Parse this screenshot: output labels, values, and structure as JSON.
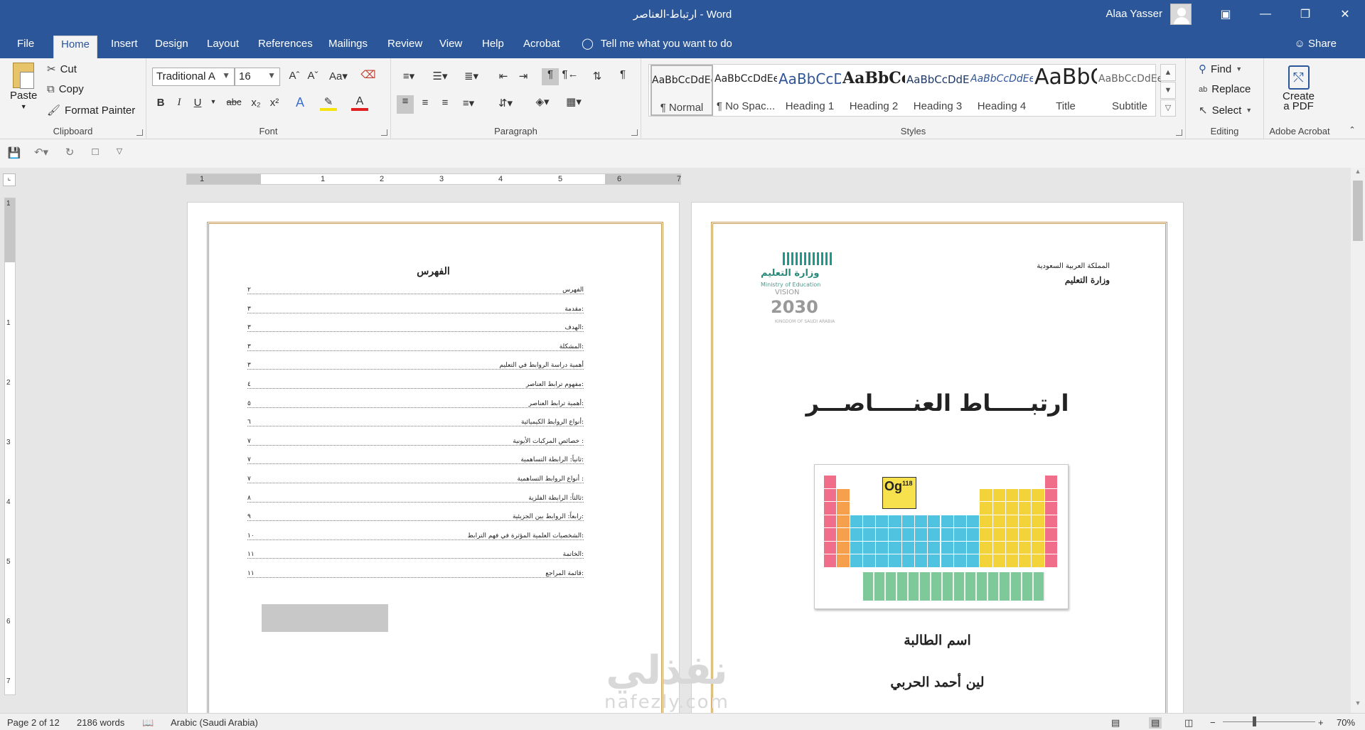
{
  "window": {
    "title": "ارتباط-العناصر  -  Word",
    "user": "Alaa Yasser"
  },
  "tabs": [
    "File",
    "Home",
    "Insert",
    "Design",
    "Layout",
    "References",
    "Mailings",
    "Review",
    "View",
    "Help",
    "Acrobat"
  ],
  "tell_me": "Tell me what you want to do",
  "share": "Share",
  "clipboard": {
    "paste": "Paste",
    "cut": "Cut",
    "copy": "Copy",
    "format_painter": "Format Painter",
    "label": "Clipboard"
  },
  "font": {
    "name": "Traditional A",
    "size": "16",
    "label": "Font"
  },
  "paragraph": {
    "label": "Paragraph"
  },
  "styles": {
    "label": "Styles",
    "items": [
      {
        "preview": "AaBbCcDdEe",
        "name": "¶ Normal"
      },
      {
        "preview": "AaBbCcDdEe",
        "name": "¶ No Spac..."
      },
      {
        "preview": "AaBbCcDdE",
        "name": "Heading 1"
      },
      {
        "preview": "AaBbCcDdEe",
        "name": "Heading 2"
      },
      {
        "preview": "AaBbCcDdEe",
        "name": "Heading 3"
      },
      {
        "preview": "AaBbCcDdEe",
        "name": "Heading 4"
      },
      {
        "preview": "AaBbCcDdEe",
        "name": "Title"
      },
      {
        "preview": "AaBbCcDdEe",
        "name": "Subtitle"
      }
    ]
  },
  "editing": {
    "find": "Find",
    "replace": "Replace",
    "select": "Select",
    "label": "Editing"
  },
  "acrobat": {
    "create_line1": "Create",
    "create_line2": "a PDF",
    "label": "Adobe Acrobat"
  },
  "ruler_numbers": [
    "1",
    "1",
    "2",
    "3",
    "4",
    "5",
    "6",
    "7"
  ],
  "vruler_numbers": [
    "1",
    "1",
    "2",
    "3",
    "4",
    "5",
    "6",
    "7"
  ],
  "toc": {
    "title": "الفهرس",
    "entries": [
      {
        "title": "الفهرس",
        "page": "٢"
      },
      {
        "title": "مقدمة:",
        "page": "٣"
      },
      {
        "title": "الهدف:",
        "page": "٣"
      },
      {
        "title": "المشكلة:",
        "page": "٣"
      },
      {
        "title": "أهمية دراسة الروابط في التعليم",
        "page": "٣"
      },
      {
        "title": "مفهوم ترابط العناصر:",
        "page": "٤"
      },
      {
        "title": "أهمية ترابط العناصر:",
        "page": "٥"
      },
      {
        "title": "أنواع الروابط الكيميائية:",
        "page": "٦"
      },
      {
        "title": "خصائص المركبات الأيونية :",
        "page": "٧"
      },
      {
        "title": "ثانياً: الرابطة التساهمية:",
        "page": "٧"
      },
      {
        "title": "أنواع الروابط التساهمية :",
        "page": "٧"
      },
      {
        "title": "ثالثاً: الرابطة الفلزية:",
        "page": "٨"
      },
      {
        "title": "رابعاً: الروابط بين الجزيئية:",
        "page": "٩"
      },
      {
        "title": "الشخصيات العلمية المؤثرة في فهم الترابط:",
        "page": "١٠"
      },
      {
        "title": "الخاتمة:",
        "page": "١١"
      },
      {
        "title": "قائمة المراجع:",
        "page": "١١"
      }
    ]
  },
  "cover": {
    "kingdom": "المملكة العربية السعودية",
    "ministry": "وزارة التعليم",
    "logo_ar": "وزارة التعليم",
    "logo_en": "Ministry of Education",
    "logo_vision": "VISION",
    "logo_year": "2030",
    "logo_ks": "KINGDOM OF SAUDI ARABIA",
    "title": "ارتبـــــاط العنـــــاصـــر",
    "element_symbol": "Og",
    "element_number": "118",
    "student_label": "اسم الطالبة",
    "student_name": "لين أحمد الحربي"
  },
  "watermark": {
    "ar": "نفذلي",
    "en": "nafezly.com"
  },
  "status": {
    "page": "Page 2 of 12",
    "words": "2186 words",
    "language": "Arabic (Saudi Arabia)",
    "zoom": "70%"
  },
  "colors": {
    "brand": "#2b579a",
    "page_border": "#c89a58"
  }
}
